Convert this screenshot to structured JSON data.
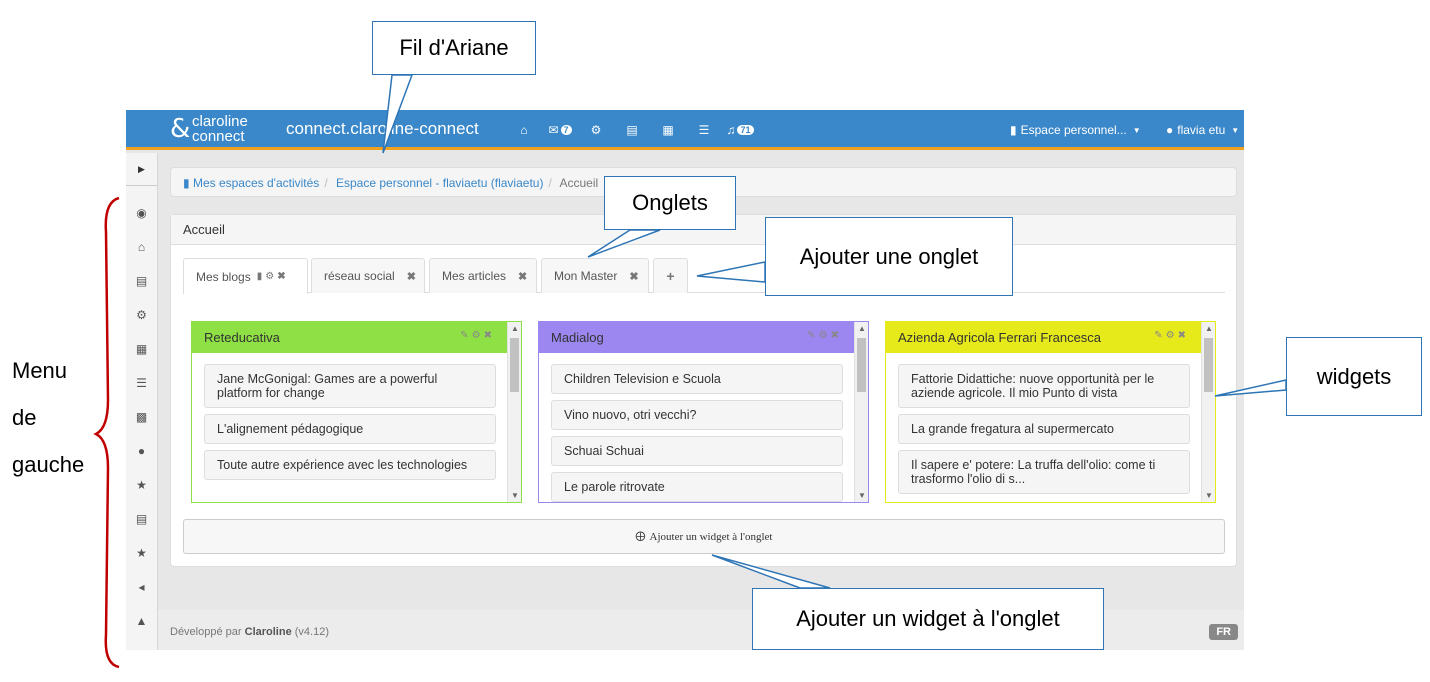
{
  "topbar": {
    "logo_top": "claroline",
    "logo_bottom": "connect",
    "title": "connect.claroline-connect",
    "mail_badge": "7",
    "notif_badge": "71",
    "workspace_menu": "Espace personnel...",
    "user_menu": "flavia etu",
    "colors": {
      "bar": "#3a88c9",
      "accent_line": "#f0a020"
    }
  },
  "breadcrumb": {
    "items": [
      "Mes espaces d'activités",
      "Espace personnel - flaviaetu (flaviaetu)",
      "Accueil"
    ]
  },
  "panel": {
    "heading": "Accueil",
    "tabs": [
      {
        "label": "Mes blogs"
      },
      {
        "label": "réseau social"
      },
      {
        "label": "Mes articles"
      },
      {
        "label": "Mon Master"
      }
    ],
    "add_tab_symbol": "+",
    "add_widget_label": "Ajouter un widget à l'onglet"
  },
  "widgets": [
    {
      "title": "Reteducativa",
      "color": "#8ee044",
      "border": "#8ee044",
      "items": [
        "Jane McGonigal: Games are a powerful platform for change",
        "L'alignement pédagogique",
        "Toute autre expérience avec les technologies"
      ]
    },
    {
      "title": "Madialog",
      "color": "#9b87ef",
      "border": "#9b87ef",
      "items": [
        "Children Television e Scuola",
        "Vino nuovo, otri vecchi?",
        "Schuai Schuai",
        "Le parole ritrovate"
      ]
    },
    {
      "title": "Azienda Agricola Ferrari Francesca",
      "color": "#e6ea1a",
      "border": "#e6ea1a",
      "items": [
        "Fattorie Didattiche: nuove opportunità per le aziende agricole. Il mio Punto di vista",
        "La grande fregatura al supermercato",
        "Il sapere e' potere: La truffa dell'olio: come ti trasformo l'olio di s..."
      ]
    }
  ],
  "footer": {
    "prefix": "Développé par",
    "brand": "Claroline",
    "version": "(v4.12)",
    "lang": "FR"
  },
  "annotations": {
    "fil_ariane": "Fil d'Ariane",
    "onglets": "Onglets",
    "ajouter_onglet": "Ajouter une onglet",
    "widgets": "widgets",
    "ajouter_widget": "Ajouter un widget à l'onglet",
    "menu_lines": [
      "Menu",
      "de",
      "gauche"
    ]
  }
}
